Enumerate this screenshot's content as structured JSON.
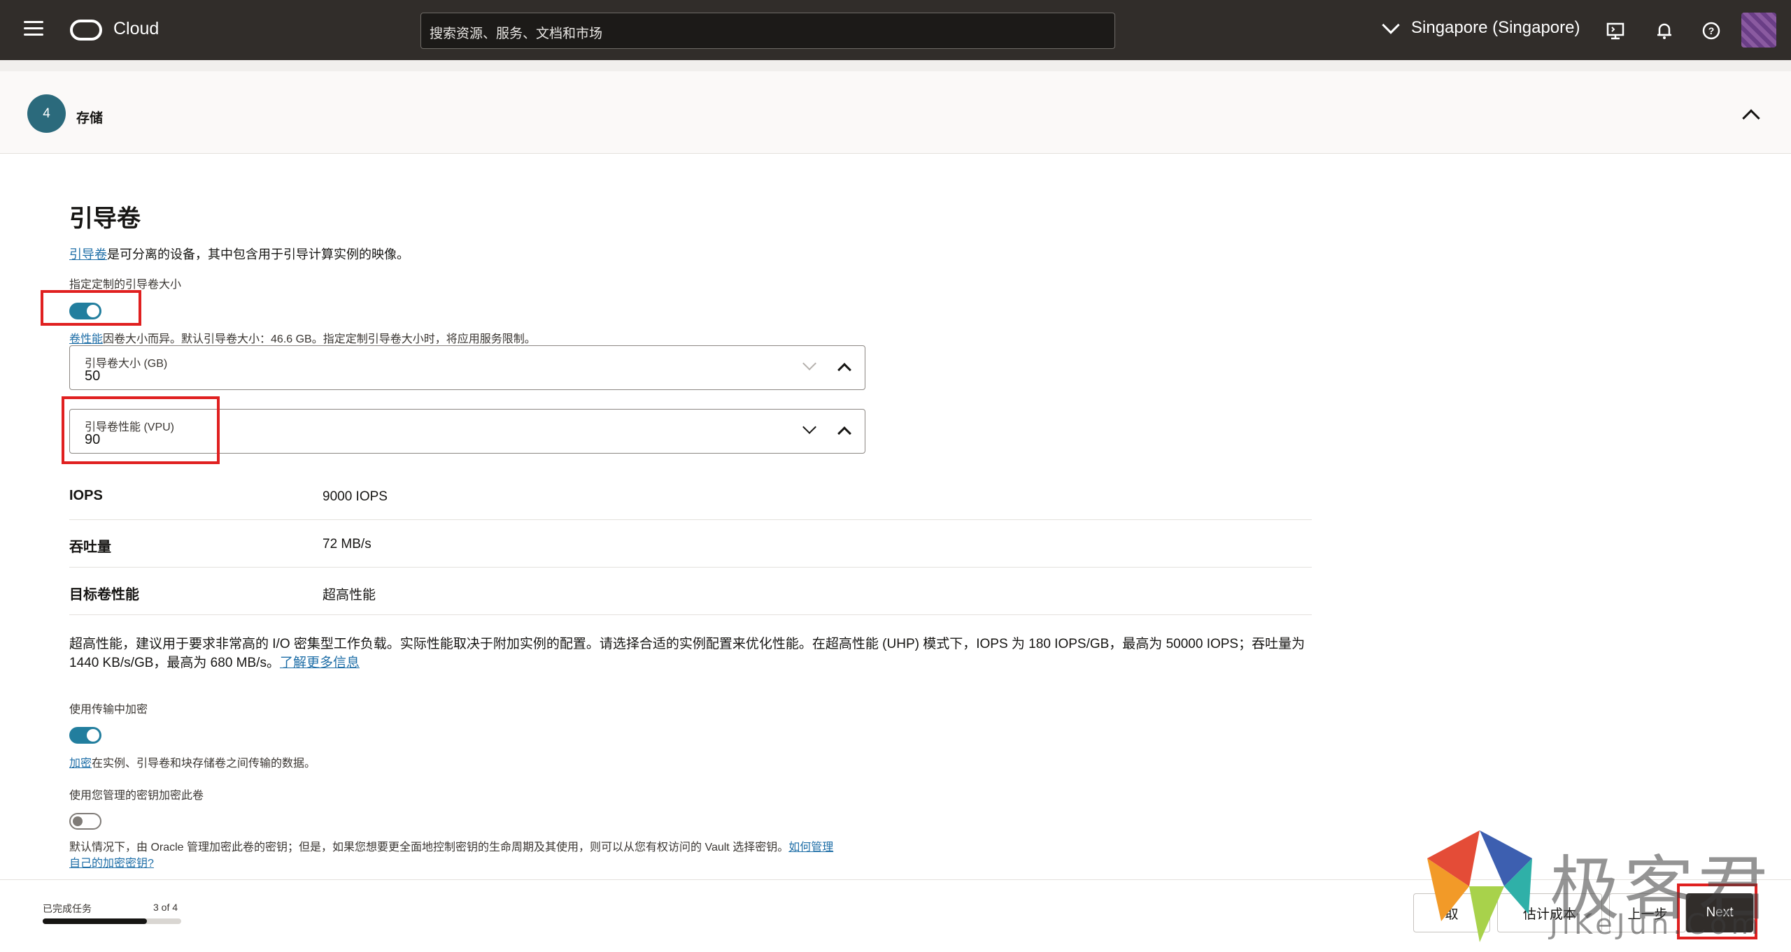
{
  "topbar": {
    "brand": "Cloud",
    "search_placeholder": "搜索资源、服务、文档和市场",
    "region": "Singapore (Singapore)"
  },
  "step": {
    "number": "4",
    "title": "存储"
  },
  "boot_volume": {
    "heading": "引导卷",
    "desc_link": "引导卷",
    "desc_rest": "是可分离的设备，其中包含用于引导计算实例的映像。",
    "custom_size_label": "指定定制的引导卷大小",
    "custom_size_on": true,
    "perf_link": "卷性能",
    "perf_hint": "因卷大小而异。默认引导卷大小：46.6 GB。指定定制引导卷大小时，将应用服务限制。",
    "size_field": {
      "label": "引导卷大小 (GB)",
      "value": "50"
    },
    "vpu_field": {
      "label": "引导卷性能 (VPU)",
      "value": "90"
    }
  },
  "properties": [
    {
      "key": "IOPS",
      "value": "9000 IOPS"
    },
    {
      "key": "吞吐量",
      "value": "72 MB/s"
    },
    {
      "key": "目标卷性能",
      "value": "超高性能"
    }
  ],
  "uhp_note": {
    "text": "超高性能，建议用于要求非常高的 I/O 密集型工作负载。实际性能取决于附加实例的配置。请选择合适的实例配置来优化性能。在超高性能 (UHP) 模式下，IOPS 为 180 IOPS/GB，最高为 50000 IOPS；吞吐量为 1440 KB/s/GB，最高为 680 MB/s。",
    "link": "了解更多信息"
  },
  "in_transit": {
    "label": "使用传输中加密",
    "on": true,
    "link": "加密",
    "hint": "在实例、引导卷和块存储卷之间传输的数据。"
  },
  "own_key": {
    "label": "使用您管理的密钥加密此卷",
    "on": false,
    "hint": "默认情况下，由 Oracle 管理加密此卷的密钥；但是，如果您想要更全面地控制密钥的生命周期及其使用，则可以从您有权访问的 Vault 选择密钥。",
    "link_line1": "如何管理",
    "link_line2": "自己的加密密钥?"
  },
  "footer": {
    "tasks_label": "已完成任务",
    "tasks_count": "3 of 4",
    "progress": 0.75,
    "cancel": "取",
    "estimate": "估计成本",
    "prev": "上一步",
    "next": "Next"
  },
  "watermark": {
    "cn": "极客君",
    "en": "JiKeJun.Com"
  }
}
